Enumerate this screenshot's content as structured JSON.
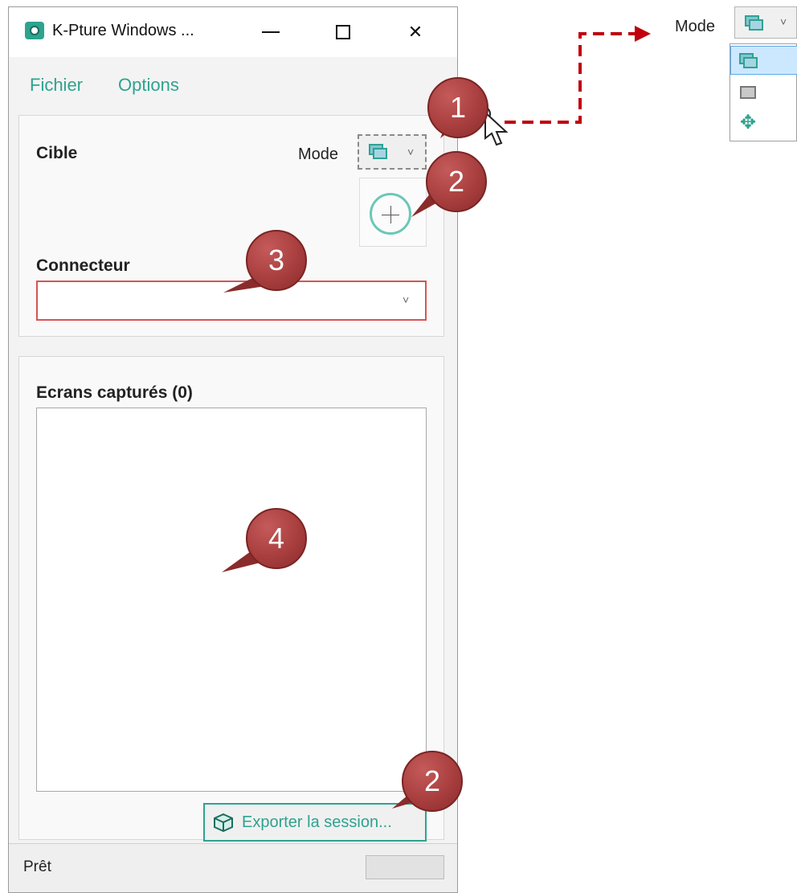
{
  "window": {
    "title": "K-Pture Windows ...",
    "controls": {
      "minimize": "minimize",
      "maximize": "maximize",
      "close": "✕"
    }
  },
  "menu": {
    "items": [
      "Fichier",
      "Options"
    ]
  },
  "target_section": {
    "label": "Cible",
    "mode_label": "Mode",
    "mode_selected_icon": "window-stack-icon",
    "crosshair_icon": "crosshair-target-icon"
  },
  "connector_section": {
    "label": "Connecteur",
    "value": "",
    "chevron": "˅"
  },
  "captures_section": {
    "label": "Ecrans capturés (0)",
    "items": [],
    "export_button": "Exporter la session..."
  },
  "status": {
    "text": "Prêt"
  },
  "callouts": [
    "1",
    "2",
    "3",
    "4",
    "2"
  ],
  "mode_preview": {
    "label": "Mode",
    "chevron": "˅",
    "options": [
      "window-stack-icon",
      "single-window-icon",
      "move-arrows-icon"
    ],
    "selected_index": 0
  },
  "colors": {
    "accent": "#2ea38f",
    "callout": "#a83e3e",
    "arrow": "#c0000f",
    "invalid_border": "#d45555",
    "selected_item": "#cce8ff"
  }
}
